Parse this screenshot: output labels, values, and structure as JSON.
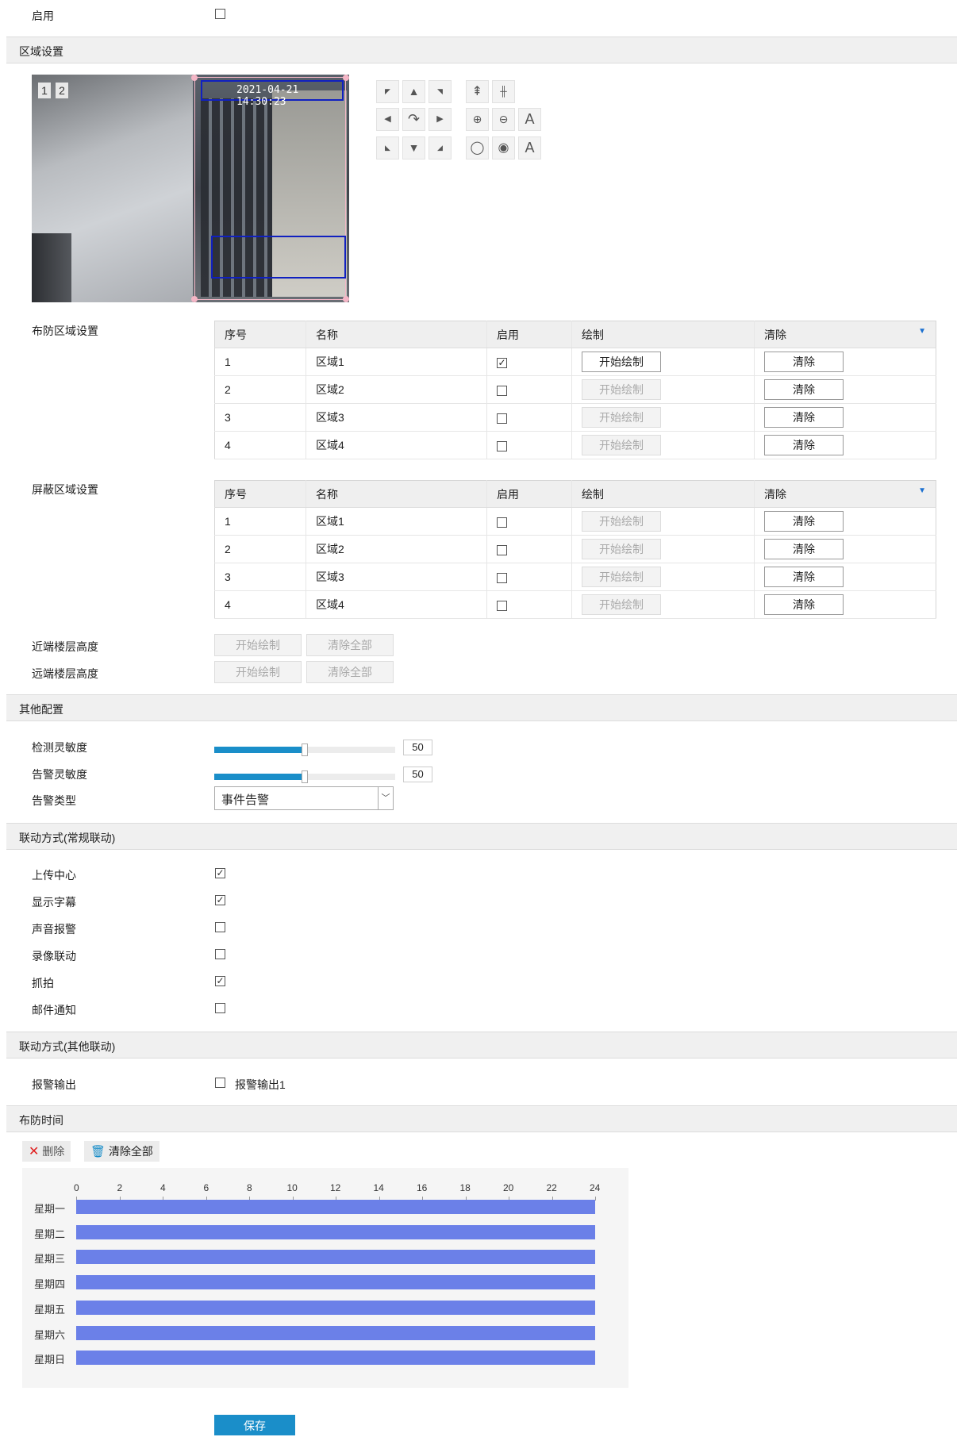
{
  "enable": {
    "label": "启用",
    "checked": false
  },
  "sections": {
    "region": "区域设置",
    "other": "其他配置",
    "linkage_normal": "联动方式(常规联动)",
    "linkage_other": "联动方式(其他联动)",
    "schedule": "布防时间"
  },
  "preview": {
    "view1": "1",
    "view2": "2",
    "timestamp": "2021-04-21 14:30:23"
  },
  "ptz": {
    "text_a1": "A",
    "text_a2": "A"
  },
  "arm_area": {
    "label": "布防区域设置",
    "headers": [
      "序号",
      "名称",
      "启用",
      "绘制",
      "清除"
    ],
    "rows": [
      {
        "no": "1",
        "name": "区域1",
        "enabled": true,
        "draw": "开始绘制",
        "clear": "清除"
      },
      {
        "no": "2",
        "name": "区域2",
        "enabled": false,
        "draw": "开始绘制",
        "clear": "清除"
      },
      {
        "no": "3",
        "name": "区域3",
        "enabled": false,
        "draw": "开始绘制",
        "clear": "清除"
      },
      {
        "no": "4",
        "name": "区域4",
        "enabled": false,
        "draw": "开始绘制",
        "clear": "清除"
      }
    ]
  },
  "mask_area": {
    "label": "屏蔽区域设置",
    "headers": [
      "序号",
      "名称",
      "启用",
      "绘制",
      "清除"
    ],
    "rows": [
      {
        "no": "1",
        "name": "区域1",
        "enabled": false,
        "draw": "开始绘制",
        "clear": "清除"
      },
      {
        "no": "2",
        "name": "区域2",
        "enabled": false,
        "draw": "开始绘制",
        "clear": "清除"
      },
      {
        "no": "3",
        "name": "区域3",
        "enabled": false,
        "draw": "开始绘制",
        "clear": "清除"
      },
      {
        "no": "4",
        "name": "区域4",
        "enabled": false,
        "draw": "开始绘制",
        "clear": "清除"
      }
    ]
  },
  "near_floor": {
    "label": "近端楼层高度",
    "draw": "开始绘制",
    "clear_all": "清除全部"
  },
  "far_floor": {
    "label": "远端楼层高度",
    "draw": "开始绘制",
    "clear_all": "清除全部"
  },
  "detect_sensitivity": {
    "label": "检测灵敏度",
    "value": "50",
    "fraction": 0.5
  },
  "alarm_sensitivity": {
    "label": "告警灵敏度",
    "value": "50",
    "fraction": 0.5
  },
  "alarm_type": {
    "label": "告警类型",
    "value": "事件告警"
  },
  "linkage": [
    {
      "label": "上传中心",
      "checked": true
    },
    {
      "label": "显示字幕",
      "checked": true
    },
    {
      "label": "声音报警",
      "checked": false
    },
    {
      "label": "录像联动",
      "checked": false
    },
    {
      "label": "抓拍",
      "checked": true
    },
    {
      "label": "邮件通知",
      "checked": false
    }
  ],
  "alarm_output": {
    "label": "报警输出",
    "option": "报警输出1",
    "checked": false
  },
  "schedule": {
    "delete": "删除",
    "clear_all": "清除全部",
    "ticks": [
      "0",
      "2",
      "4",
      "6",
      "8",
      "10",
      "12",
      "14",
      "16",
      "18",
      "20",
      "22",
      "24"
    ],
    "days": [
      "星期一",
      "星期二",
      "星期三",
      "星期四",
      "星期五",
      "星期六",
      "星期日"
    ],
    "ranges": [
      [
        0,
        24
      ],
      [
        0,
        24
      ],
      [
        0,
        24
      ],
      [
        0,
        24
      ],
      [
        0,
        24
      ],
      [
        0,
        24
      ],
      [
        0,
        24
      ]
    ],
    "bar_color": "#6b80e8"
  },
  "save": "保存"
}
